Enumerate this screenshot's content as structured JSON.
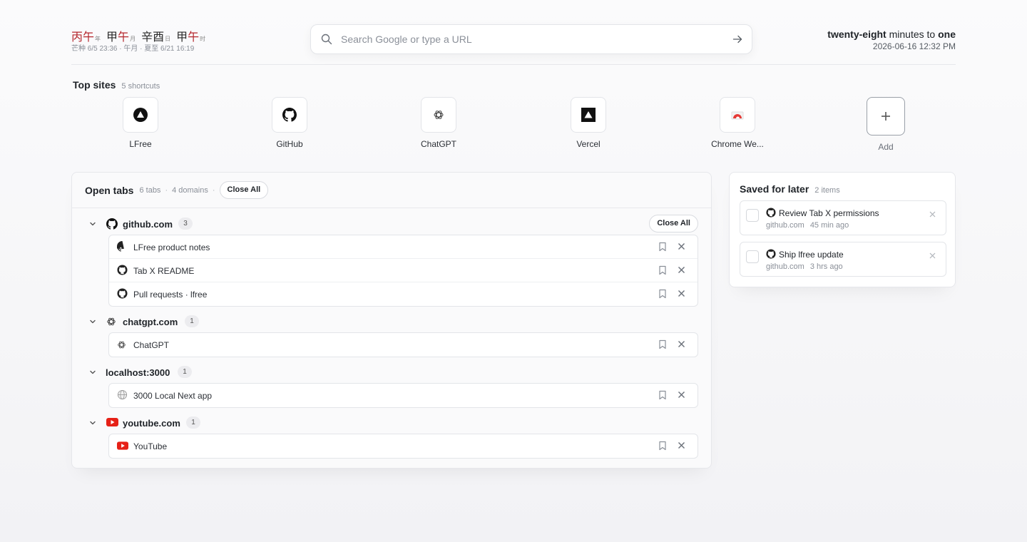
{
  "header": {
    "ganzhi": [
      {
        "stem": "丙",
        "branch": "午",
        "unit": "年"
      },
      {
        "stem": "甲",
        "branch": "午",
        "unit": "月"
      },
      {
        "stem": "辛",
        "branch": "酉",
        "unit": "日"
      },
      {
        "stem": "甲",
        "branch": "午",
        "unit": "时"
      }
    ],
    "ganzhi_sub": "芒种 6/5 23:36 · 午月 · 夏至 6/21 16:19",
    "search_placeholder": "Search Google or type a URL",
    "clock_words": {
      "a": "twenty-eight",
      "mid": "minutes to",
      "b": "one"
    },
    "clock_date": "2026-06-16 12:32 PM"
  },
  "top_sites": {
    "title": "Top sites",
    "subtitle": "5 shortcuts",
    "items": [
      {
        "label": "LFree",
        "icon": "lfree-triangle-icon"
      },
      {
        "label": "GitHub",
        "icon": "github-icon"
      },
      {
        "label": "ChatGPT",
        "icon": "chatgpt-icon"
      },
      {
        "label": "Vercel",
        "icon": "vercel-icon"
      },
      {
        "label": "Chrome We...",
        "icon": "chrome-webstore-icon"
      }
    ],
    "add_label": "Add"
  },
  "open_tabs": {
    "title": "Open tabs",
    "tabs_count": "6 tabs",
    "domains_count": "4 domains",
    "sep": "·",
    "close_all": "Close All",
    "groups": [
      {
        "domain": "github.com",
        "count": "3",
        "close_all": "Close All",
        "tabs": [
          "LFree product notes",
          "Tab X README",
          "Pull requests · lfree"
        ]
      },
      {
        "domain": "chatgpt.com",
        "count": "1",
        "tabs": [
          "ChatGPT"
        ]
      },
      {
        "domain": "localhost:3000",
        "count": "1",
        "tabs": [
          "3000 Local Next app"
        ]
      },
      {
        "domain": "youtube.com",
        "count": "1",
        "tabs": [
          "YouTube"
        ]
      }
    ]
  },
  "saved": {
    "title": "Saved for later",
    "subtitle": "2 items",
    "items": [
      {
        "title": "Review Tab X permissions",
        "domain": "github.com",
        "time": "45 min ago"
      },
      {
        "title": "Ship lfree update",
        "domain": "github.com",
        "time": "3 hrs ago"
      }
    ]
  },
  "colors": {
    "accent_red": "#b5282e",
    "youtube_red": "#e62117",
    "background": "#f5f5f7"
  }
}
